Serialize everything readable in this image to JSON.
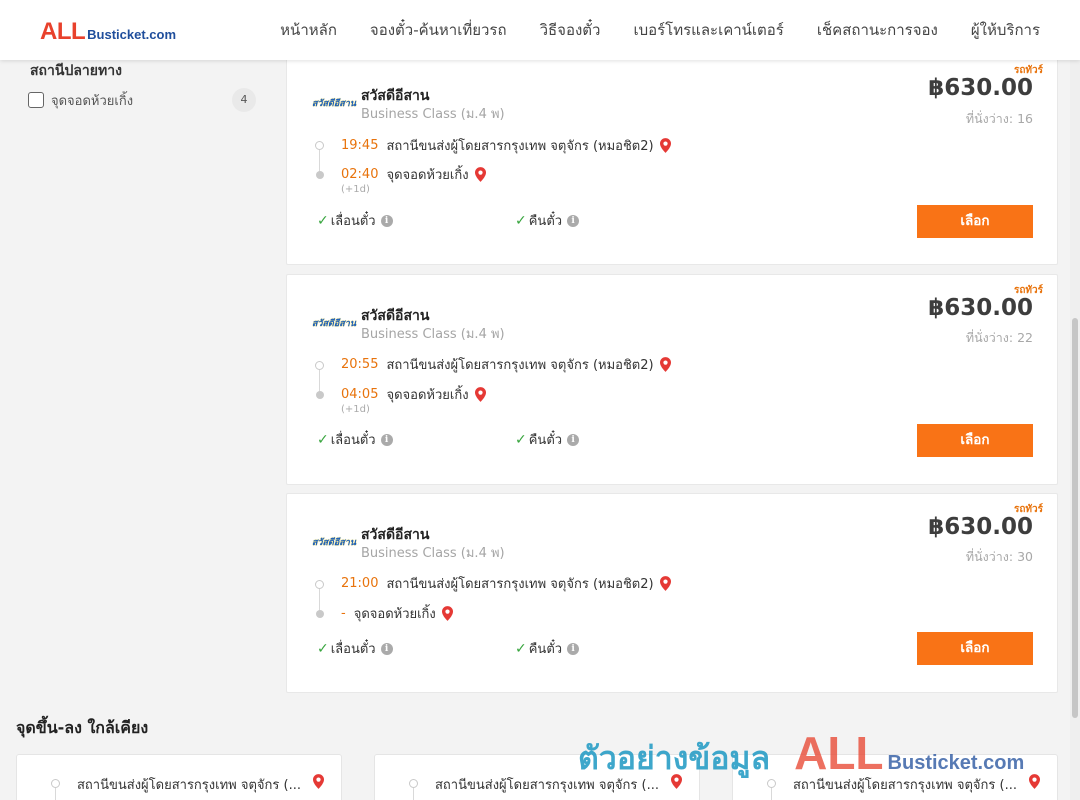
{
  "header": {
    "logo_all": "ALL",
    "logo_rest": "Busticket.com",
    "nav": [
      "หน้าหลัก",
      "จองตั๋ว-ค้นหาเที่ยวรถ",
      "วิธีจองตั๋ว",
      "เบอร์โทรและเคาน์เตอร์",
      "เช็คสถานะการจอง",
      "ผู้ให้บริการ"
    ]
  },
  "filter": {
    "title": "สถานีปลายทาง",
    "option_label": "จุดจอดห้วยเกิ้ง",
    "option_count": "4"
  },
  "trips": [
    {
      "tag": "รถทัวร์",
      "operator_logo_text": "สวัสดีอีสาน",
      "operator": "สวัสดีอีสาน",
      "class": "Business Class (ม.4 พ)",
      "price": "฿630.00",
      "seats_label": "ที่นั่งว่าง:",
      "seats": "16",
      "dep_time": "19:45",
      "dep_station": "สถานีขนส่งผู้โดยสารกรุงเทพ จตุจักร (หมอชิต2)",
      "arr_time": "02:40",
      "arr_station": "จุดจอดห้วยเกิ้ง",
      "next_day": "(+1d)",
      "feature_1": "เลื่อนตั๋ว",
      "feature_2": "คืนตั๋ว",
      "button": "เลือก"
    },
    {
      "tag": "รถทัวร์",
      "operator_logo_text": "สวัสดีอีสาน",
      "operator": "สวัสดีอีสาน",
      "class": "Business Class (ม.4 พ)",
      "price": "฿630.00",
      "seats_label": "ที่นั่งว่าง:",
      "seats": "22",
      "dep_time": "20:55",
      "dep_station": "สถานีขนส่งผู้โดยสารกรุงเทพ จตุจักร (หมอชิต2)",
      "arr_time": "04:05",
      "arr_station": "จุดจอดห้วยเกิ้ง",
      "next_day": "(+1d)",
      "feature_1": "เลื่อนตั๋ว",
      "feature_2": "คืนตั๋ว",
      "button": "เลือก"
    },
    {
      "tag": "รถทัวร์",
      "operator_logo_text": "สวัสดีอีสาน",
      "operator": "สวัสดีอีสาน",
      "class": "Business Class (ม.4 พ)",
      "price": "฿630.00",
      "seats_label": "ที่นั่งว่าง:",
      "seats": "30",
      "dep_time": "21:00",
      "dep_station": "สถานีขนส่งผู้โดยสารกรุงเทพ จตุจักร (หมอชิต2)",
      "arr_time": "-",
      "arr_station": "จุดจอดห้วยเกิ้ง",
      "next_day": "",
      "feature_1": "เลื่อนตั๋ว",
      "feature_2": "คืนตั๋ว",
      "button": "เลือก"
    }
  ],
  "nearby": {
    "title": "จุดขึ้น-ลง ใกล้เคียง",
    "items": [
      "สถานีขนส่งผู้โดยสารกรุงเทพ จตุจักร (...",
      "สถานีขนส่งผู้โดยสารกรุงเทพ จตุจักร (...",
      "สถานีขนส่งผู้โดยสารกรุงเทพ จตุจักร (..."
    ]
  },
  "watermark": {
    "text": "ตัวอย่างข้อมูล",
    "logo_all": "ALL",
    "logo_rest": "Busticket.com"
  },
  "colors": {
    "accent": "#f97316",
    "time": "#e8730c",
    "brand_red": "#e8412c",
    "brand_blue": "#1f4e9c",
    "check": "#38a53e"
  }
}
